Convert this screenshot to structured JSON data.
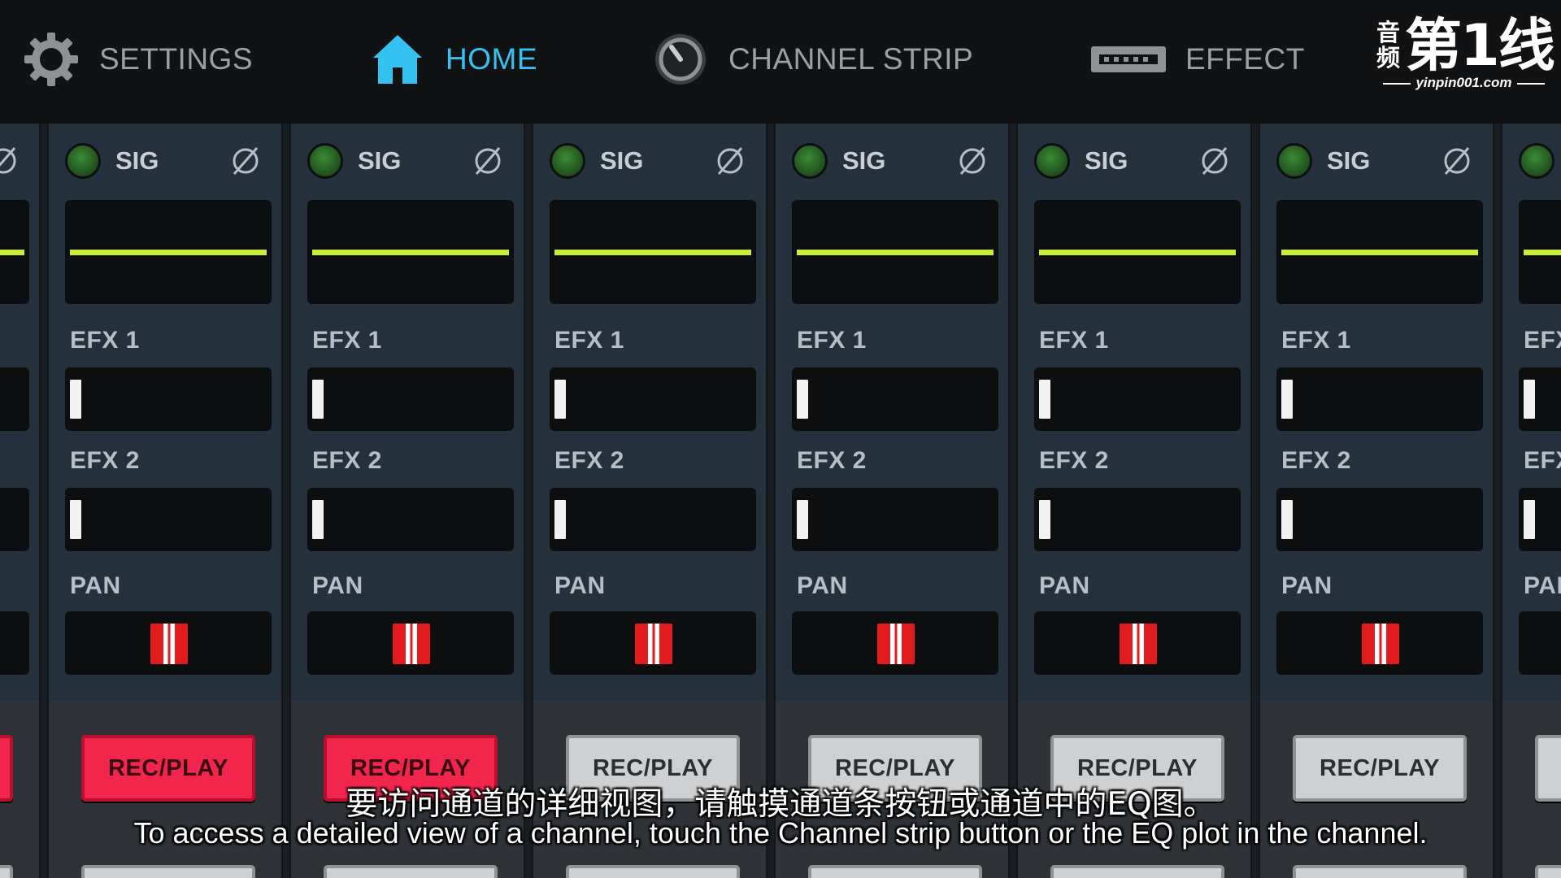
{
  "nav": {
    "settings": {
      "label": "SETTINGS",
      "icon": "gear-icon"
    },
    "home": {
      "label": "HOME",
      "icon": "home-icon",
      "active": true
    },
    "channel_strip": {
      "label": "CHANNEL STRIP",
      "icon": "knob-icon"
    },
    "effect": {
      "label": "EFFECT",
      "icon": "rack-icon"
    }
  },
  "logo": {
    "cn_small": "音频",
    "cn_big": "第1线",
    "url": "yinpin001.com"
  },
  "colors": {
    "accent_active": "#34c3f0",
    "eq_curve": "#c6ee3a",
    "rec_on": "#f2264d",
    "rec_off": "#cfd0d1",
    "pan_knob": "#e21b1f"
  },
  "strip_labels": {
    "sig": "SIG",
    "efx1": "EFX 1",
    "efx2": "EFX 2",
    "pan": "PAN",
    "rec_play": "REC/PLAY"
  },
  "channels": [
    {
      "rec_active": true
    },
    {
      "rec_active": true
    },
    {
      "rec_active": true
    },
    {
      "rec_active": false
    },
    {
      "rec_active": false
    },
    {
      "rec_active": false
    },
    {
      "rec_active": false
    },
    {
      "rec_active": false
    }
  ],
  "subtitles": {
    "cn": "要访问通道的详细视图，请触摸通道条按钮或通道中的EQ图。",
    "en": "To access a detailed view of a channel, touch the Channel strip button or the EQ plot in the channel."
  }
}
